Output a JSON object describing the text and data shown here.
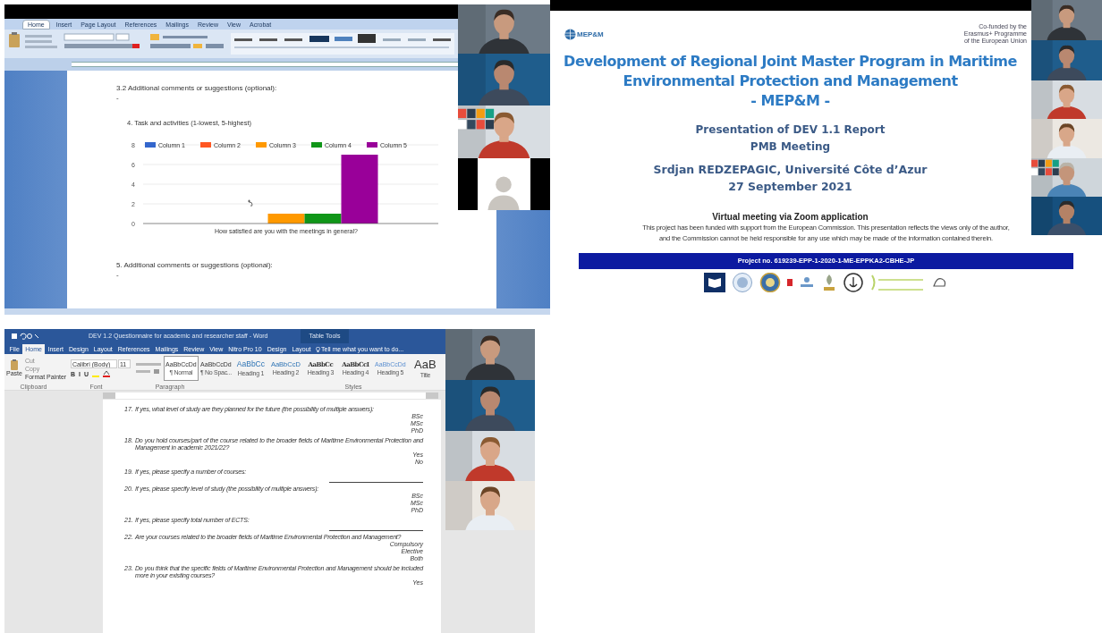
{
  "word_window_1": {
    "tabs": [
      {
        "label": "Home",
        "selected": true
      },
      {
        "label": "Insert",
        "selected": false
      },
      {
        "label": "Page Layout",
        "selected": false
      },
      {
        "label": "References",
        "selected": false
      },
      {
        "label": "Mailings",
        "selected": false
      },
      {
        "label": "Review",
        "selected": false
      },
      {
        "label": "View",
        "selected": false
      },
      {
        "label": "Acrobat",
        "selected": false
      }
    ],
    "comment_heading": "3.2 Additional comments or suggestions (optional):",
    "comment_value": "-",
    "chart_heading": "4. Task and activities (1-lowest, 5-highest)",
    "chart_data": {
      "type": "bar",
      "categories": [
        "How satisfied are you with the meetings in general?"
      ],
      "series": [
        {
          "name": "Column 1",
          "color": "#3366cc",
          "values": [
            0
          ]
        },
        {
          "name": "Column 2",
          "color": "#ff5722",
          "values": [
            0
          ]
        },
        {
          "name": "Column 3",
          "color": "#ff9900",
          "values": [
            1
          ]
        },
        {
          "name": "Column 4",
          "color": "#109618",
          "values": [
            1
          ]
        },
        {
          "name": "Column 5",
          "color": "#990099",
          "values": [
            7
          ]
        }
      ],
      "ylim": [
        0,
        8
      ],
      "yticks": [
        0,
        2,
        4,
        6,
        8
      ],
      "grid": true,
      "legend": true
    },
    "question_heading": "5. Additional comments or suggestions (optional):",
    "question_value": "-",
    "videos": [
      {
        "kind": "camera"
      },
      {
        "kind": "camera"
      },
      {
        "kind": "camera"
      },
      {
        "kind": "avatar"
      }
    ]
  },
  "slide_window": {
    "logo_text": "MEP&M",
    "cofunded": [
      "Co-funded by the",
      "Erasmus+ Programme",
      "of the European Union"
    ],
    "title": [
      "Development of Regional Joint Master Program in Maritime",
      "Environmental Protection and Management",
      "- MEP&M -"
    ],
    "subtitle": [
      "Presentation of DEV 1.1 Report",
      "PMB Meeting"
    ],
    "author": "Srdjan REDZEPAGIC, Université Côte d’Azur",
    "date": "27 September 2021",
    "meeting": "Virtual meeting via Zoom application",
    "disclaimer": [
      "This project has been funded with support from the European Commission. This presentation reflects the views only of the author,",
      "and the Commission cannot be held responsible for any use which may be made of the information contained therein."
    ],
    "project": "Project no. 619239-EPP-1-2020-1-ME-EPPKA2-CBHE-JP",
    "videos": [
      {
        "kind": "camera"
      },
      {
        "kind": "camera"
      },
      {
        "kind": "camera"
      },
      {
        "kind": "camera"
      },
      {
        "kind": "camera"
      },
      {
        "kind": "camera"
      }
    ]
  },
  "word_window_2": {
    "title": "DEV 1.2 Questionnaire for academic and researcher staff - Word",
    "context_tab": "Table Tools",
    "tabs": [
      {
        "label": "File",
        "selected": false
      },
      {
        "label": "Home",
        "selected": true
      },
      {
        "label": "Insert",
        "selected": false
      },
      {
        "label": "Design",
        "selected": false
      },
      {
        "label": "Layout",
        "selected": false
      },
      {
        "label": "References",
        "selected": false
      },
      {
        "label": "Mailings",
        "selected": false
      },
      {
        "label": "Review",
        "selected": false
      },
      {
        "label": "View",
        "selected": false
      },
      {
        "label": "Nitro Pro 10",
        "selected": false
      },
      {
        "label": "Design",
        "selected": false
      },
      {
        "label": "Layout",
        "selected": false
      }
    ],
    "tell_me": "Tell me what you want to do...",
    "clipboard": {
      "paste": "Paste",
      "items": [
        "Cut",
        "Copy",
        "Format Painter"
      ]
    },
    "font": "Calibri (Body)",
    "font_size": "11",
    "format_buttons": [
      "B",
      "I",
      "U"
    ],
    "styles": [
      {
        "sample": "AaBbCcDd",
        "name": "¶ Normal",
        "selected": true
      },
      {
        "sample": "AaBbCcDd",
        "name": "¶ No Spac...",
        "selected": false
      },
      {
        "sample": "AaBbCc",
        "name": "Heading 1",
        "selected": false
      },
      {
        "sample": "AaBbCcD",
        "name": "Heading 2",
        "selected": false
      },
      {
        "sample": "AaBbCc",
        "name": "Heading 3",
        "selected": false
      },
      {
        "sample": "AaBbCcI",
        "name": "Heading 4",
        "selected": false
      },
      {
        "sample": "AaBbCcDd",
        "name": "Heading 5",
        "selected": false
      },
      {
        "sample": "AaB",
        "name": "Title",
        "selected": false
      }
    ],
    "groups": [
      "Clipboard",
      "Font",
      "Paragraph",
      "Styles"
    ],
    "questions": [
      {
        "kind": "choice",
        "number": "17.",
        "text": "If yes, what level of study are they planned for the future (the possibility of multiple answers):",
        "answers": [
          "BSc",
          "MSc",
          "PhD"
        ]
      },
      {
        "kind": "choice",
        "number": "18.",
        "text": "Do you hold courses/part of the course related to the broader fields of Maritime Environmental Protection and Management in academic 2021/22?",
        "answers": [
          "Yes",
          "No"
        ]
      },
      {
        "kind": "blank",
        "number": "19.",
        "text": "If yes, please specify a number of courses:"
      },
      {
        "kind": "choice",
        "number": "20.",
        "text": "If yes, please specify level of study (the possibility of multiple answers):",
        "answers": [
          "BSc",
          "MSc",
          "PhD"
        ]
      },
      {
        "kind": "blank",
        "number": "21.",
        "text": "If yes, please specify total number of ECTS:"
      },
      {
        "kind": "choice",
        "number": "22.",
        "text": "Are your courses related to the broader fields of Maritime Environmental Protection and Management?",
        "answers": [
          "Compulsory",
          "Elective",
          "Both"
        ]
      },
      {
        "kind": "choice",
        "number": "23.",
        "text": "Do you think that the specific fields of Maritime Environmental Protection and Management should be included more in your existing courses?",
        "answers": [
          "Yes"
        ]
      }
    ],
    "videos": [
      {
        "kind": "camera"
      },
      {
        "kind": "camera"
      },
      {
        "kind": "camera"
      },
      {
        "kind": "camera"
      }
    ]
  }
}
